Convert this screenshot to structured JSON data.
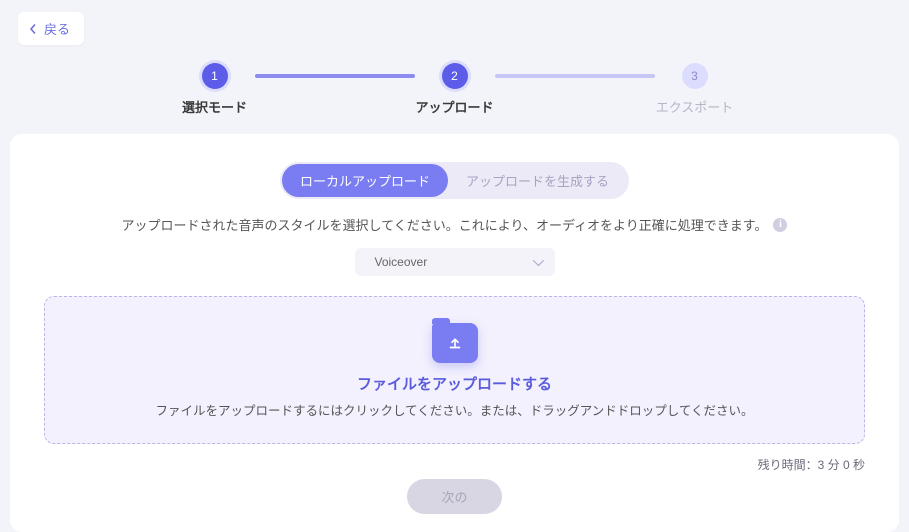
{
  "back_label": "戻る",
  "stepper": {
    "steps": [
      {
        "num": "1",
        "label": "選択モード"
      },
      {
        "num": "2",
        "label": "アップロード"
      },
      {
        "num": "3",
        "label": "エクスポート"
      }
    ]
  },
  "tabs": {
    "local": "ローカルアップロード",
    "generate": "アップロードを生成する"
  },
  "helper_text": "アップロードされた音声のスタイルを選択してください。これにより、オーディオをより正確に処理できます。",
  "style_select": {
    "value": "Voiceover"
  },
  "dropzone": {
    "title": "ファイルをアップロードする",
    "subtitle": "ファイルをアップロードするにはクリックしてください。または、ドラッグアンドドロップしてください。"
  },
  "remaining_label": "残り時間：3 分 0 秒",
  "next_label": "次の"
}
